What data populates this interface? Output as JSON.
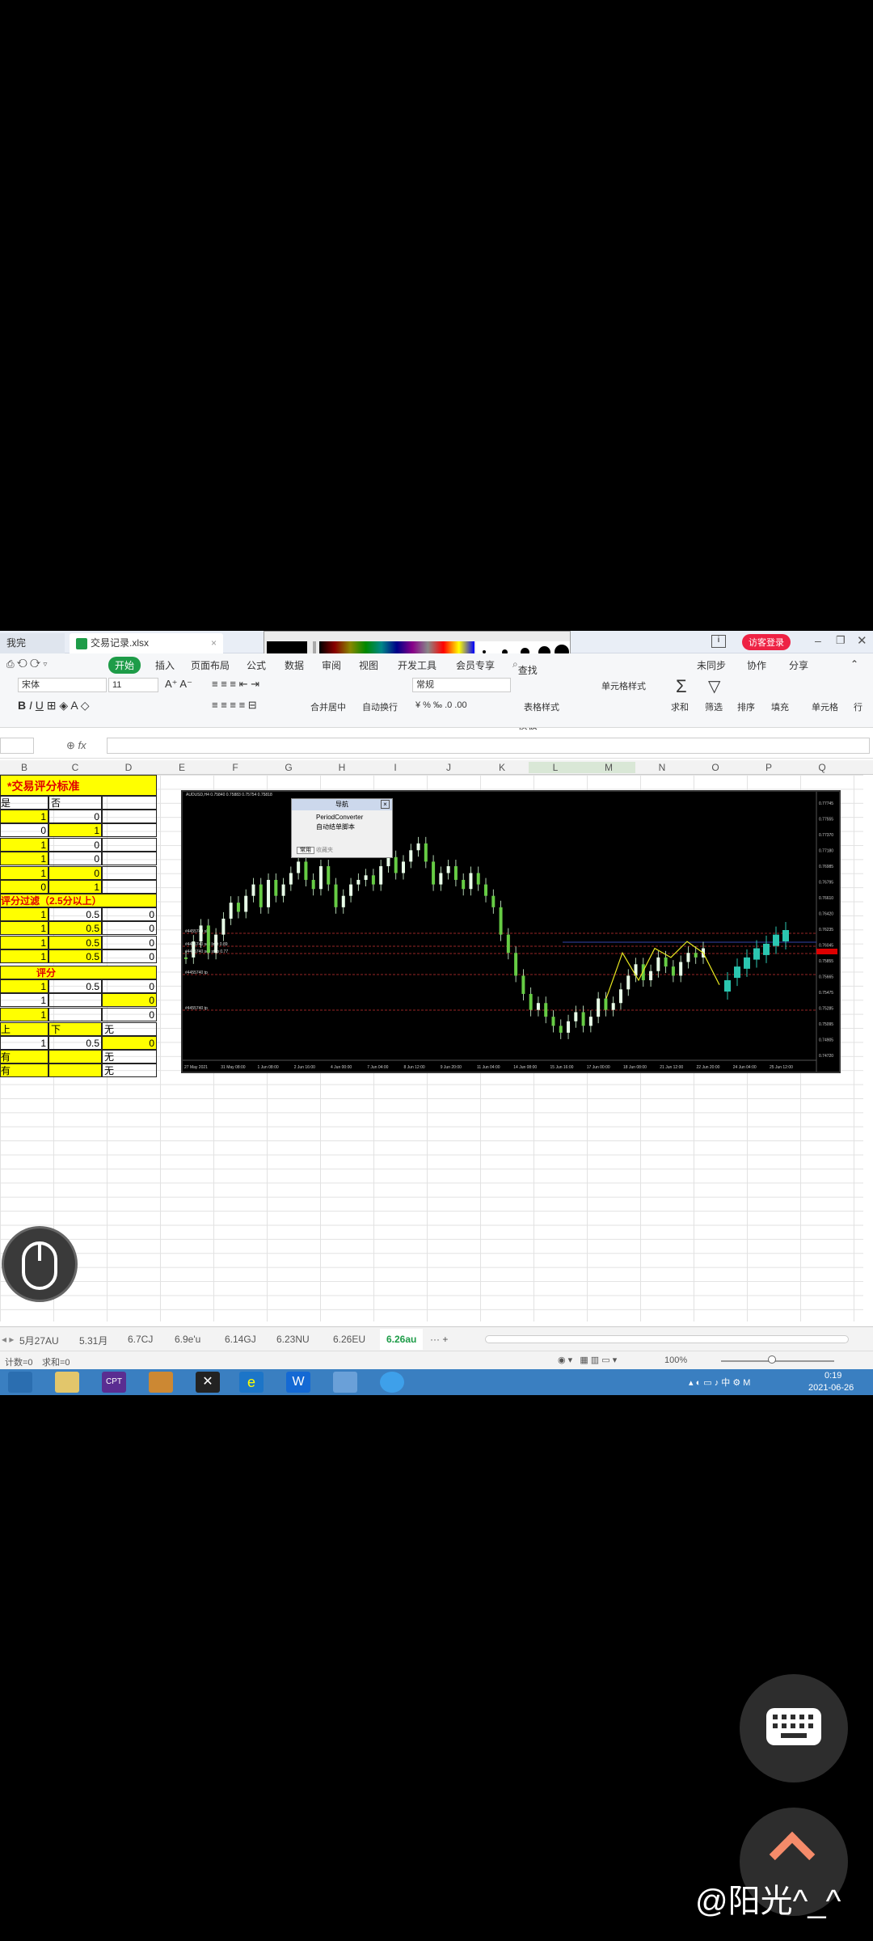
{
  "window": {
    "tab_left": "我完",
    "tab_file": "交易记录.xlsx",
    "login": "访客登录"
  },
  "ribbon_tabs": [
    "开始",
    "插入",
    "页面布局",
    "公式",
    "数据",
    "审阅",
    "视图",
    "开发工具",
    "会员专享"
  ],
  "search_placeholder": "查找命令、搜索模板",
  "ribbon_right": [
    "未同步",
    "协作",
    "分享"
  ],
  "toolbar": {
    "font_name": "宋体",
    "font_size": "11",
    "merge": "合并居中",
    "wrap": "自动换行",
    "number_format": "常规",
    "table_style": "表格样式",
    "cell_style": "单元格样式",
    "sum": "求和",
    "filter": "筛选",
    "sort": "排序",
    "fill": "填充",
    "cells": "单元格",
    "row": "行"
  },
  "fx_label": "fx",
  "columns": [
    "B",
    "C",
    "D",
    "E",
    "F",
    "G",
    "H",
    "I",
    "J",
    "K",
    "L",
    "M",
    "N",
    "O",
    "P",
    "Q"
  ],
  "sheet": {
    "title": "*交易评分标准",
    "header_a": "是",
    "header_b": "否",
    "rows1": [
      [
        "1",
        "0"
      ],
      [
        "0",
        "1"
      ],
      [
        "1",
        "0"
      ],
      [
        "1",
        "0"
      ],
      [
        "1",
        "0"
      ],
      [
        "0",
        "1"
      ]
    ],
    "section2": "评分过滤（2.5分以上）",
    "rows2": [
      [
        "1",
        "0.5",
        "0"
      ],
      [
        "1",
        "0.5",
        "0"
      ],
      [
        "1",
        "0.5",
        "0"
      ],
      [
        "1",
        "0.5",
        "0"
      ]
    ],
    "section3": "评分",
    "rows3": [
      [
        "1",
        "0.5",
        "0"
      ],
      [
        "1",
        "",
        "0"
      ],
      [
        "1",
        "",
        "0"
      ]
    ],
    "row_updown": [
      "上",
      "下",
      "无"
    ],
    "row_last": [
      "1",
      "0.5",
      "0"
    ],
    "row_you1": [
      "有",
      "",
      "无"
    ],
    "row_you2": [
      "有",
      "",
      "无"
    ]
  },
  "chart_window": {
    "header": "AUDUSD,H4  0.75840 0.75883 0.75754 0.75818",
    "nav_title": "导航",
    "nav_items": [
      "PeriodConverter",
      "自动结单脚本"
    ],
    "nav_tabs": [
      "常用",
      "收藏夹"
    ],
    "price_labels": [
      "0.77745",
      "0.77555",
      "0.77370",
      "0.77180",
      "0.76985",
      "0.76795",
      "0.76610",
      "0.76420",
      "0.76235",
      "0.76045",
      "0.75855",
      "0.75665",
      "0.75475",
      "0.75285",
      "0.75095",
      "0.74905",
      "0.74720"
    ],
    "date_labels": [
      "27 May 2021",
      "31 May 08:00",
      "1 Jun 08:00",
      "2 Jun 16:00",
      "4 Jun 00:00",
      "7 Jun 04:00",
      "8 Jun 12:00",
      "9 Jun 20:00",
      "11 Jun 04:00",
      "14 Jun 08:00",
      "15 Jun 16:00",
      "17 Jun 00:00",
      "18 Jun 08:00",
      "21 Jun 12:00",
      "22 Jun 20:00",
      "24 Jun 04:00",
      "25 Jun 12:00"
    ],
    "order_lines": [
      "#4455740 sl",
      "#4455740 sell limit 0.89",
      "#4455740 sell stop 0.77",
      "#4455740 tp",
      "#4455740 tp"
    ]
  },
  "sheet_tabs": [
    "5月27AU",
    "5.31月",
    "6.7CJ",
    "6.9e'u",
    "6.14GJ",
    "6.23NU",
    "6.26EU",
    "6.26au"
  ],
  "status": {
    "count": "计数=0",
    "sum": "求和=0",
    "zoom": "100%"
  },
  "taskbar": {
    "time": "0:19",
    "date": "2021-06-26",
    "lang": "中",
    "ime": "M"
  },
  "watermark": "@阳光^_^",
  "colors": {
    "yellow": "#ffff00",
    "accent": "#3a7fc1",
    "tab_green": "#1e9c48",
    "red": "#e00000"
  }
}
